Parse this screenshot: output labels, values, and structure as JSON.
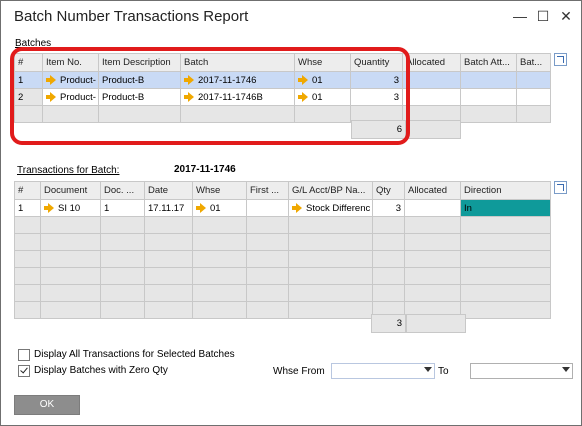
{
  "window": {
    "title": "Batch Number Transactions Report"
  },
  "batches": {
    "label": "Batches",
    "columns": [
      "#",
      "Item No.",
      "Item Description",
      "Batch",
      "Whse",
      "Quantity",
      "Allocated",
      "Batch Att...",
      "Bat..."
    ],
    "rows": [
      {
        "num": "1",
        "item_no": "Product-",
        "desc": "Product-B",
        "batch": "2017-11-1746",
        "whse": "01",
        "qty": "3",
        "allocated": ""
      },
      {
        "num": "2",
        "item_no": "Product-",
        "desc": "Product-B",
        "batch": "2017-11-1746B",
        "whse": "01",
        "qty": "3",
        "allocated": ""
      }
    ],
    "total_qty": "6"
  },
  "transactions": {
    "label": "Transactions for Batch:",
    "batch_value": "2017-11-1746",
    "columns": [
      "#",
      "Document",
      "Doc. ...",
      "Date",
      "Whse",
      "First ...",
      "G/L Acct/BP Na...",
      "Qty",
      "Allocated",
      "Direction"
    ],
    "rows": [
      {
        "num": "1",
        "document": "SI 10",
        "doc_num": "1",
        "date": "17.11.17",
        "whse": "01",
        "first": "",
        "gl": "Stock Differenc",
        "qty": "3",
        "allocated": "",
        "direction": "In"
      }
    ],
    "total_qty": "3"
  },
  "options": {
    "display_all_label": "Display All Transactions for Selected Batches",
    "display_all_checked": false,
    "display_zero_label": "Display Batches with Zero Qty",
    "display_zero_checked": true,
    "whse_from_label": "Whse From",
    "to_label": "To",
    "whse_from_value": "",
    "to_value": ""
  },
  "buttons": {
    "ok": "OK"
  },
  "colors": {
    "highlight": "#e11b1b",
    "direction_in": "#0f9a9a",
    "selected_row": "#c9daf5",
    "link_arrow": "#f0a800"
  }
}
